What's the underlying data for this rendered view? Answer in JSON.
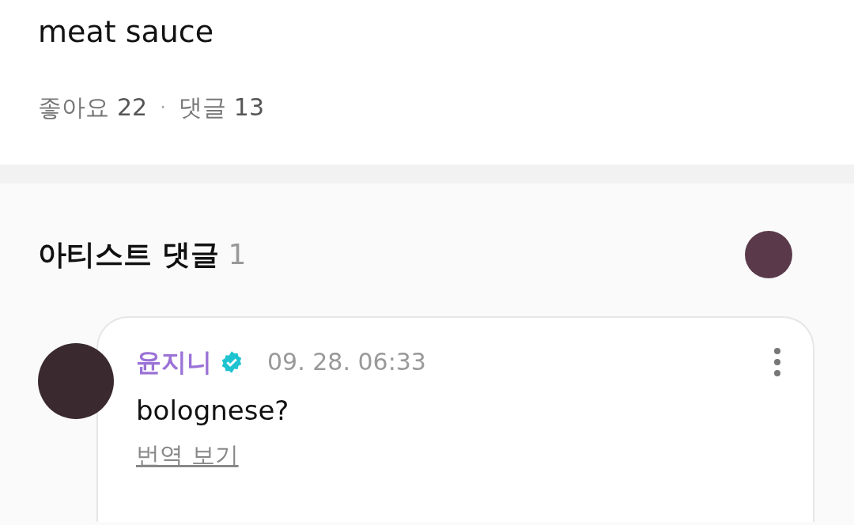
{
  "post": {
    "text": "meat sauce",
    "likes_label": "좋아요",
    "likes": "22",
    "separator": "·",
    "comments_label": "댓글",
    "comments": "13"
  },
  "artist_comments": {
    "title": "아티스트 댓글",
    "count": "1"
  },
  "comments": [
    {
      "author": "윤지니",
      "verified": true,
      "time": "09. 28. 06:33",
      "text": "bolognese?",
      "translate": "번역 보기"
    }
  ]
}
